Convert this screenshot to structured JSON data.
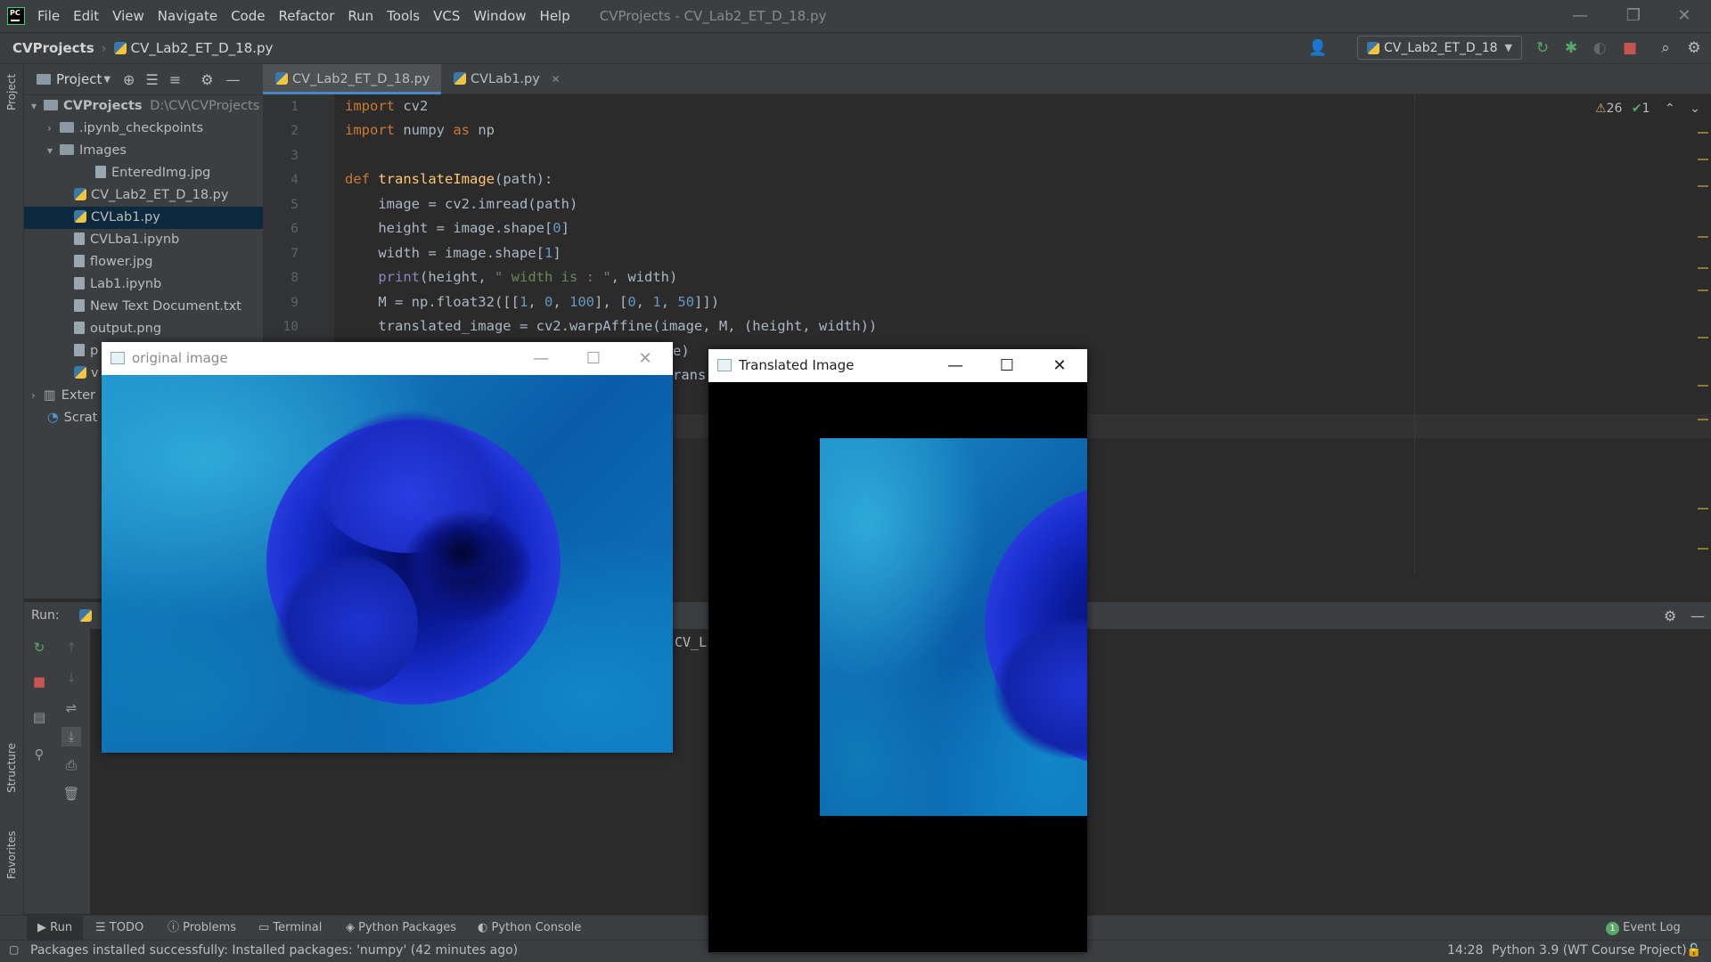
{
  "titlebar": {
    "menu": [
      "File",
      "Edit",
      "View",
      "Navigate",
      "Code",
      "Refactor",
      "Run",
      "Tools",
      "VCS",
      "Window",
      "Help"
    ],
    "window_title": "CVProjects - CV_Lab2_ET_D_18.py",
    "minimize": "—",
    "restore": "❐",
    "close": "✕"
  },
  "navbar": {
    "project": "CVProjects",
    "separator": "›",
    "file": "CV_Lab2_ET_D_18.py",
    "run_config": "CV_Lab2_ET_D_18"
  },
  "left_stripe": {
    "project": "Project",
    "structure": "Structure",
    "favorites": "Favorites"
  },
  "project_panel": {
    "title": "Project",
    "tree": [
      {
        "label": "CVProjects",
        "path": "D:\\CV\\CVProjects"
      },
      {
        "label": ".ipynb_checkpoints"
      },
      {
        "label": "Images"
      },
      {
        "label": "EnteredImg.jpg"
      },
      {
        "label": "CV_Lab2_ET_D_18.py"
      },
      {
        "label": "CVLab1.py"
      },
      {
        "label": "CVLba1.ipynb"
      },
      {
        "label": "flower.jpg"
      },
      {
        "label": "Lab1.ipynb"
      },
      {
        "label": "New Text Document.txt"
      },
      {
        "label": "output.png"
      },
      {
        "label": "p"
      },
      {
        "label": "v"
      },
      {
        "label": "Exter"
      },
      {
        "label": "Scrat"
      }
    ]
  },
  "editor": {
    "tabs": [
      {
        "label": "CV_Lab2_ET_D_18.py",
        "close": "✕"
      },
      {
        "label": "CVLab1.py",
        "close": "✕"
      }
    ],
    "line_numbers": [
      "1",
      "2",
      "3",
      "4",
      "5",
      "6",
      "7",
      "8",
      "9",
      "10"
    ],
    "inspections": {
      "warnings": "26",
      "ok": "1"
    },
    "partial_lines": {
      "l11": "e)",
      "l12": "rans"
    }
  },
  "run_panel": {
    "label": "Run:",
    "output_partial": "CV_L"
  },
  "bottom_tools": [
    {
      "label": "Run"
    },
    {
      "label": "TODO"
    },
    {
      "label": "Problems"
    },
    {
      "label": "Terminal"
    },
    {
      "label": "Python Packages"
    },
    {
      "label": "Python Console"
    },
    {
      "label": "Event Log",
      "badge": "1"
    }
  ],
  "status": {
    "message": "Packages installed successfully: Installed packages: 'numpy' (42 minutes ago)",
    "position": "14:28",
    "interpreter": "Python 3.9 (WT Course Project)"
  },
  "windows": {
    "original": {
      "title": "original image",
      "minimize": "—",
      "maximize": "☐",
      "close": "✕"
    },
    "translated": {
      "title": "Translated Image",
      "minimize": "—",
      "maximize": "☐",
      "close": "✕"
    }
  },
  "colors": {
    "accent": "#4a88c7",
    "keyword": "#cc7832",
    "function": "#ffc66d",
    "number": "#6897bb",
    "string": "#6a8759"
  }
}
